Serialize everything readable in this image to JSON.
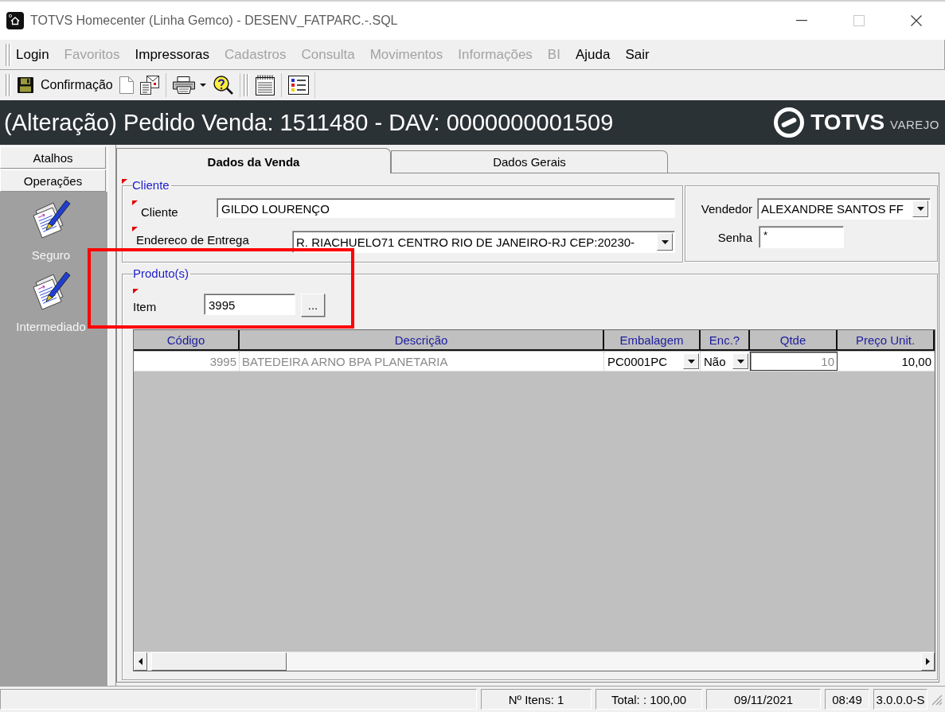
{
  "window": {
    "title": "TOTVS Homecenter (Linha Gemco) - DESENV_FATPARC.-.SQL"
  },
  "menu": [
    {
      "label": "Login",
      "disabled": false
    },
    {
      "label": "Favoritos",
      "disabled": true
    },
    {
      "label": "Impressoras",
      "disabled": false
    },
    {
      "label": "Cadastros",
      "disabled": true
    },
    {
      "label": "Consulta",
      "disabled": true
    },
    {
      "label": "Movimentos",
      "disabled": true
    },
    {
      "label": "Informações",
      "disabled": true
    },
    {
      "label": "BI",
      "disabled": true
    },
    {
      "label": "Ajuda",
      "disabled": false
    },
    {
      "label": "Sair",
      "disabled": false
    }
  ],
  "toolbar": {
    "confirm_label": "Confirmação"
  },
  "header": {
    "title": "(Alteração) Pedido Venda: 1511480 - DAV: 0000000001509",
    "logo": "TOTVS",
    "logo_suffix": "VAREJO"
  },
  "sidebar": {
    "sections": [
      "Atalhos",
      "Operações"
    ],
    "items": [
      {
        "label": "Seguro"
      },
      {
        "label": "Intermediado"
      }
    ]
  },
  "tabs": [
    {
      "label": "Dados da Venda",
      "selected": true
    },
    {
      "label": "Dados Gerais",
      "selected": false
    }
  ],
  "cliente_group": {
    "title": "Cliente",
    "required": true,
    "fields": [
      {
        "label": "Cliente",
        "kind": "text",
        "value": "GILDO LOURENÇO",
        "required": true
      },
      {
        "label": "Endereco de Entrega",
        "kind": "combo",
        "value": "R. RIACHUELO71 CENTRO RIO DE JANEIRO-RJ CEP:20230-",
        "required": true
      }
    ]
  },
  "vendedor_group": {
    "fields": [
      {
        "label": "Vendedor",
        "kind": "combo",
        "value": "ALEXANDRE SANTOS FF"
      },
      {
        "label": "Senha",
        "kind": "password",
        "value": "*"
      }
    ]
  },
  "produtos_group": {
    "title": "Produto(s)",
    "item": {
      "label": "Item",
      "value": "3995",
      "required": true
    },
    "lookup_button": "..."
  },
  "table": {
    "columns": [
      {
        "label": "Código",
        "kind": "code"
      },
      {
        "label": "Descrição",
        "kind": "text"
      },
      {
        "label": "Embalagem",
        "kind": "combo"
      },
      {
        "label": "Enc.?",
        "kind": "combo"
      },
      {
        "label": "Qtde",
        "kind": "input"
      },
      {
        "label": "Preço Unit.",
        "kind": "number"
      }
    ],
    "rows": [
      {
        "cells": [
          "3995",
          "BATEDEIRA ARNO BPA PLANETARIA",
          "PC0001PC",
          "Não",
          "10",
          "10,00"
        ]
      }
    ]
  },
  "status_bar": [
    "Nº Itens: 1",
    "Total: : 100,00",
    "09/11/2021",
    "08:49",
    "3.0.0.0-S"
  ]
}
